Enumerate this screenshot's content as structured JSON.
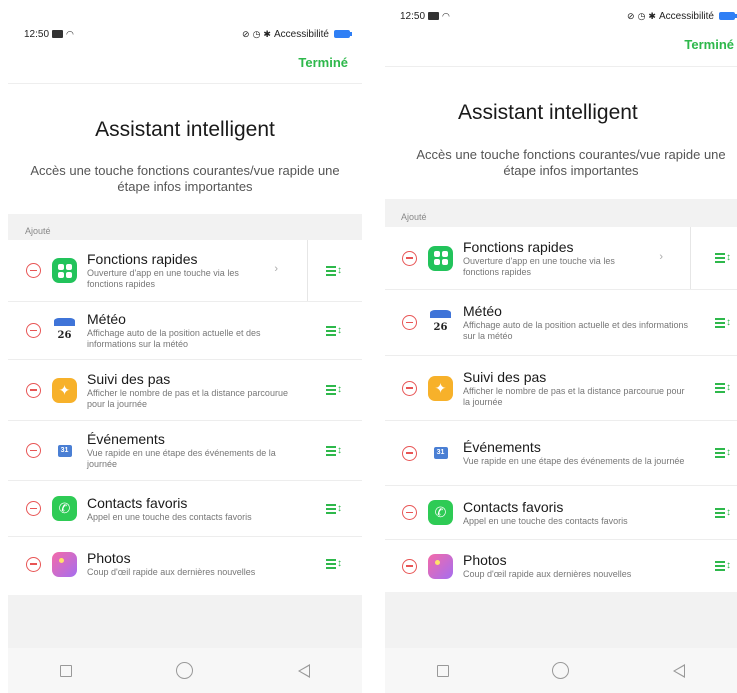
{
  "status": {
    "time": "12:50",
    "accessibility": "Accessibilité"
  },
  "header": {
    "done_label": "Terminé"
  },
  "intro": {
    "title": "Assistant intelligent",
    "subtitle": "Accès une touche fonctions courantes/vue rapide une étape infos importantes"
  },
  "section": {
    "label": "Ajouté"
  },
  "items": [
    {
      "title": "Fonctions rapides",
      "desc": "Ouverture d'app en une touche via les fonctions rapides",
      "icon": "quick-functions-icon"
    },
    {
      "title": "Météo",
      "desc": "Affichage auto de la position actuelle et des informations sur la météo",
      "icon": "weather-calendar-icon",
      "icon_text": "26"
    },
    {
      "title": "Suivi des pas",
      "desc": "Afficher le nombre de pas et la distance parcourue pour la journée",
      "icon": "runner-icon"
    },
    {
      "title": "Événements",
      "desc": "Vue rapide en une étape des événements de la journée",
      "icon": "calendar-icon",
      "icon_text": "31"
    },
    {
      "title": "Contacts favoris",
      "desc": "Appel en une touche des contacts favoris",
      "icon": "phone-icon"
    },
    {
      "title": "Photos",
      "desc": "Coup d'œil rapide aux dernières nouvelles",
      "icon": "photos-icon"
    }
  ],
  "colors": {
    "accent_green": "#2eb84b",
    "remove_red": "#e85555",
    "battery_blue": "#2f7ff5"
  }
}
